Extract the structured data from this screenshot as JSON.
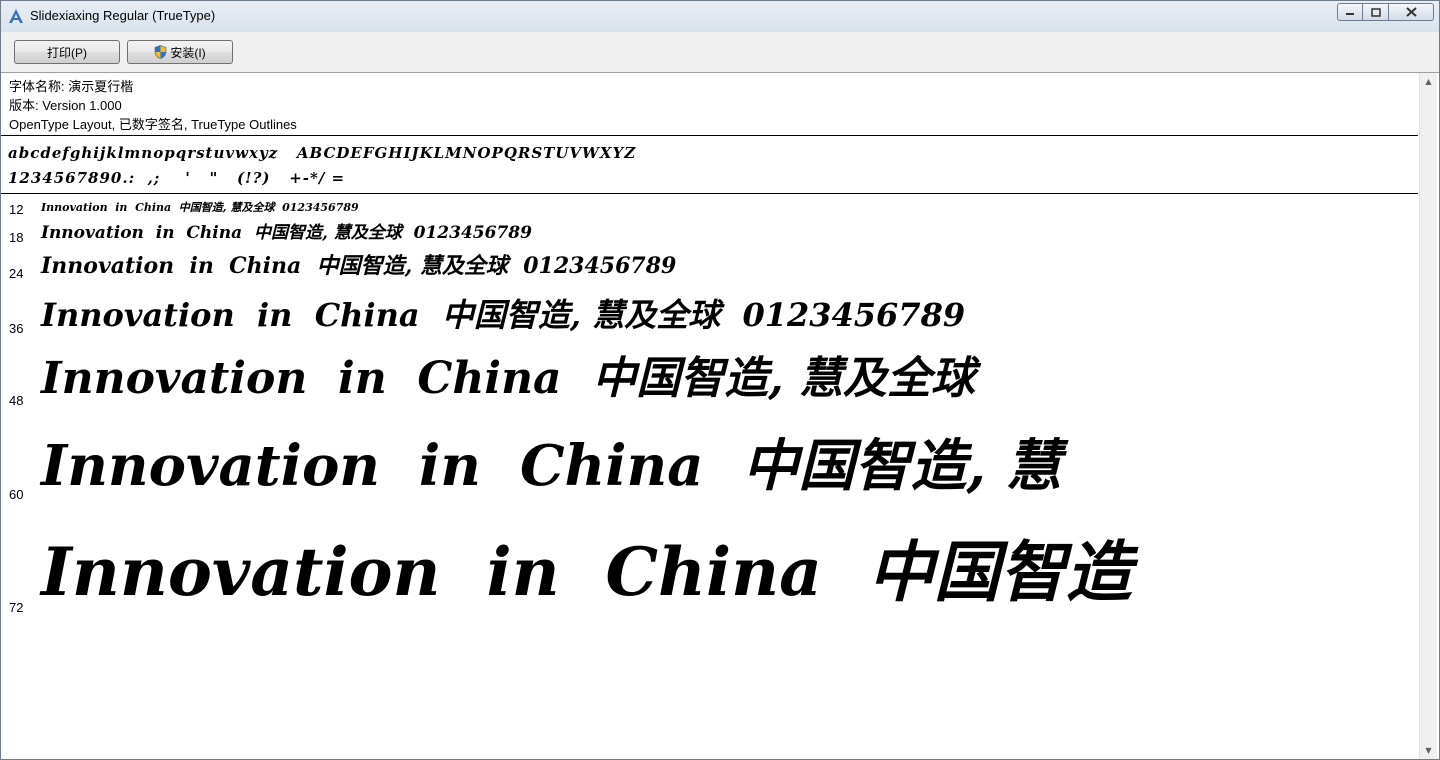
{
  "window": {
    "title": "Slidexiaxing Regular (TrueType)",
    "app_icon": "font-viewer-icon"
  },
  "toolbar": {
    "print_label": "打印(P)",
    "install_label": "安装(I)",
    "install_icon": "shield-icon"
  },
  "info": {
    "font_name": "字体名称: 演示夏行楷",
    "version": "版本: Version 1.000",
    "features": "OpenType Layout, 已数字签名, TrueType Outlines"
  },
  "charset": {
    "line1": "abcdefghijklmnopqrstuvwxyz   ABCDEFGHIJKLMNOPQRSTUVWXYZ",
    "line2": "1234567890.:  ,;    '   \"   (!?)   +-*/ ="
  },
  "samples": [
    {
      "size_label": "12",
      "text": "Innovation  in  China  中国智造, 慧及全球  0123456789"
    },
    {
      "size_label": "18",
      "text": "Innovation  in  China  中国智造, 慧及全球  0123456789"
    },
    {
      "size_label": "24",
      "text": "Innovation  in  China  中国智造, 慧及全球  0123456789"
    },
    {
      "size_label": "36",
      "text": "Innovation  in  China  中国智造, 慧及全球  0123456789"
    },
    {
      "size_label": "48",
      "text": "Innovation  in  China  中国智造, 慧及全球"
    },
    {
      "size_label": "60",
      "text": "Innovation  in  China  中国智造, 慧"
    },
    {
      "size_label": "72",
      "text": "Innovation  in  China  中国智造"
    }
  ],
  "colors": {
    "title_gradient_top": "#e9eef5",
    "toolbar_bg": "#f0f0f0",
    "text": "#000000"
  }
}
